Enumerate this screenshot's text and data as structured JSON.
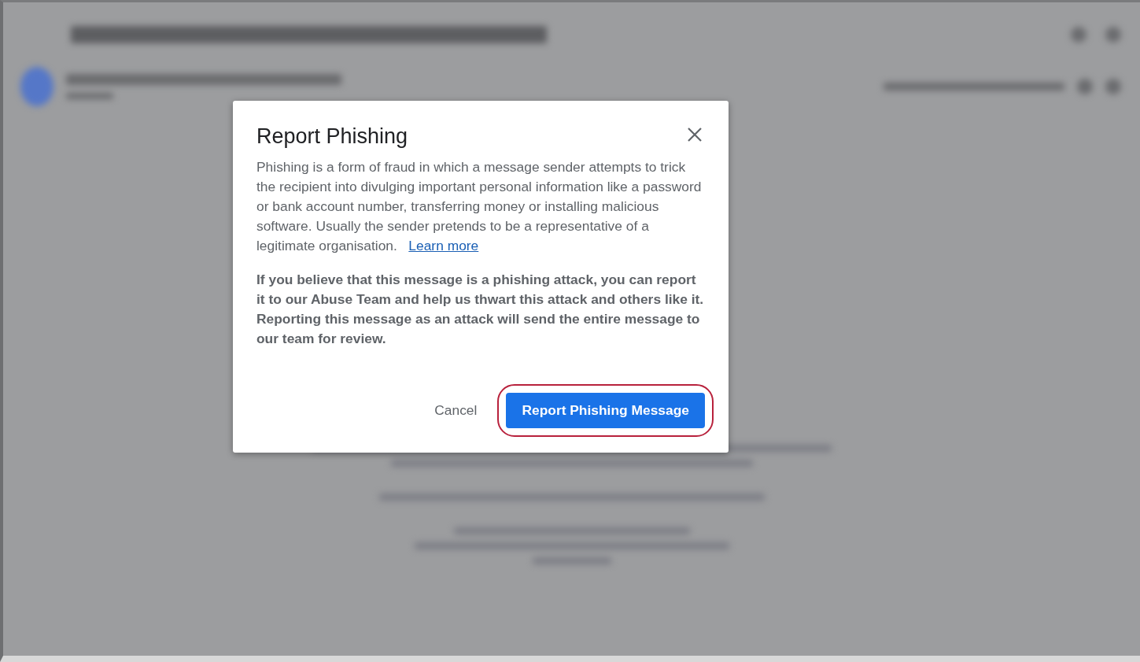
{
  "dialog": {
    "title": "Report Phishing",
    "description": "Phishing is a form of fraud in which a message sender attempts to trick the recipient into divulging important personal information like a password or bank account number, transferring money or installing malicious software. Usually the sender pretends to be a representative of a legitimate organisation.",
    "link": "Learn more",
    "notice": "If you believe that this message is a phishing attack, you can report it to our Abuse Team and help us thwart this attack and others like it. Reporting this message as an attack will send the entire message to our team for review.",
    "buttons": [
      {
        "kind": "text",
        "label": "Cancel",
        "highlighted": false
      },
      {
        "kind": "primary",
        "label": "Report Phishing Message",
        "highlighted": true
      }
    ]
  }
}
